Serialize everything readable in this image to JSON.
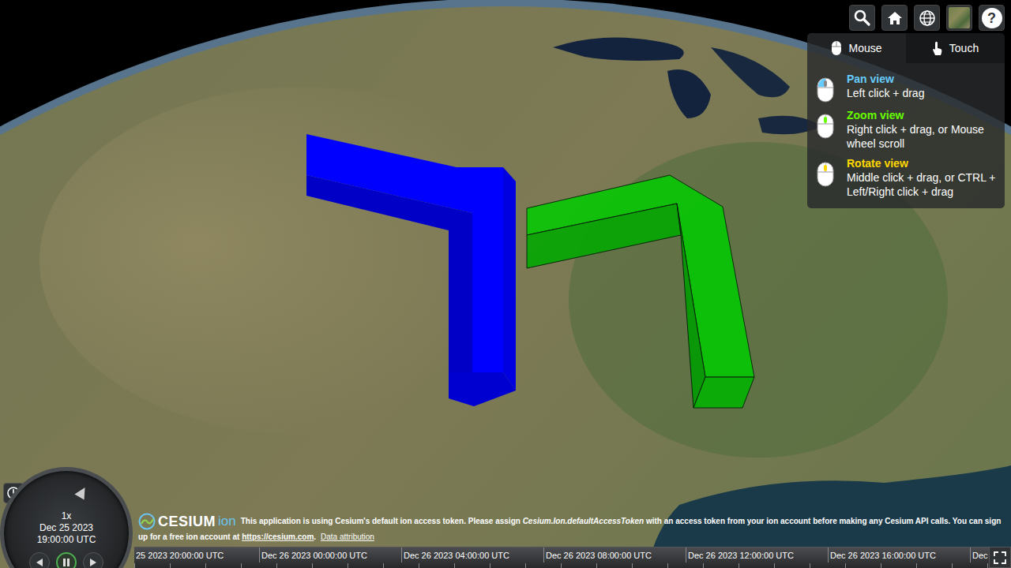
{
  "toolbar": {
    "buttons": [
      {
        "kind": "search"
      },
      {
        "kind": "home"
      },
      {
        "kind": "globe"
      },
      {
        "kind": "layers"
      }
    ],
    "help": {
      "label": "?",
      "expanded": true
    }
  },
  "navigation_help": {
    "tabs": [
      {
        "label": "Mouse",
        "selected": true
      },
      {
        "label": "Touch",
        "selected": false
      }
    ],
    "items": [
      {
        "kind": "pan",
        "title": "Pan view",
        "detail": "Left click + drag",
        "color": "#66ccff"
      },
      {
        "kind": "zoom",
        "title": "Zoom view",
        "detail": "Right click + drag, or Mouse wheel scroll",
        "color": "#66ff00"
      },
      {
        "kind": "rotate",
        "title": "Rotate view",
        "detail": "Middle click + drag, or CTRL + Left/Right click + drag",
        "color": "#ffd700"
      }
    ]
  },
  "entities": [
    {
      "color": "#0000ff"
    },
    {
      "color": "#00cc00"
    }
  ],
  "animation": {
    "speed": "1x",
    "date": "Dec 25 2023",
    "time": "19:00:00 UTC",
    "buttons": [
      {
        "kind": "reverse",
        "selected": false
      },
      {
        "kind": "pause",
        "selected": true
      },
      {
        "kind": "play",
        "selected": false
      }
    ]
  },
  "credits": {
    "logo": {
      "main": "CESIUM",
      "suffix": "ion"
    },
    "message": [
      {
        "kind": "text",
        "text": "This application is using Cesium's default ion access token. Please assign "
      },
      {
        "kind": "code",
        "text": "Cesium.Ion.defaultAccessToken"
      },
      {
        "kind": "text",
        "text": " with an access token from your ion account before making any Cesium API calls. You can sign up for a free ion account at "
      },
      {
        "kind": "link",
        "text": "https://cesium.com"
      },
      {
        "kind": "text",
        "text": "."
      }
    ],
    "attribution": "Data attribution"
  },
  "timeline": {
    "labels": [
      "25 2023 20:00:00 UTC",
      "Dec 26 2023 00:00:00 UTC",
      "Dec 26 2023 04:00:00 UTC",
      "Dec 26 2023 08:00:00 UTC",
      "Dec 26 2023 12:00:00 UTC",
      "Dec 26 2023 16:00:00 UTC",
      "Dec"
    ]
  }
}
